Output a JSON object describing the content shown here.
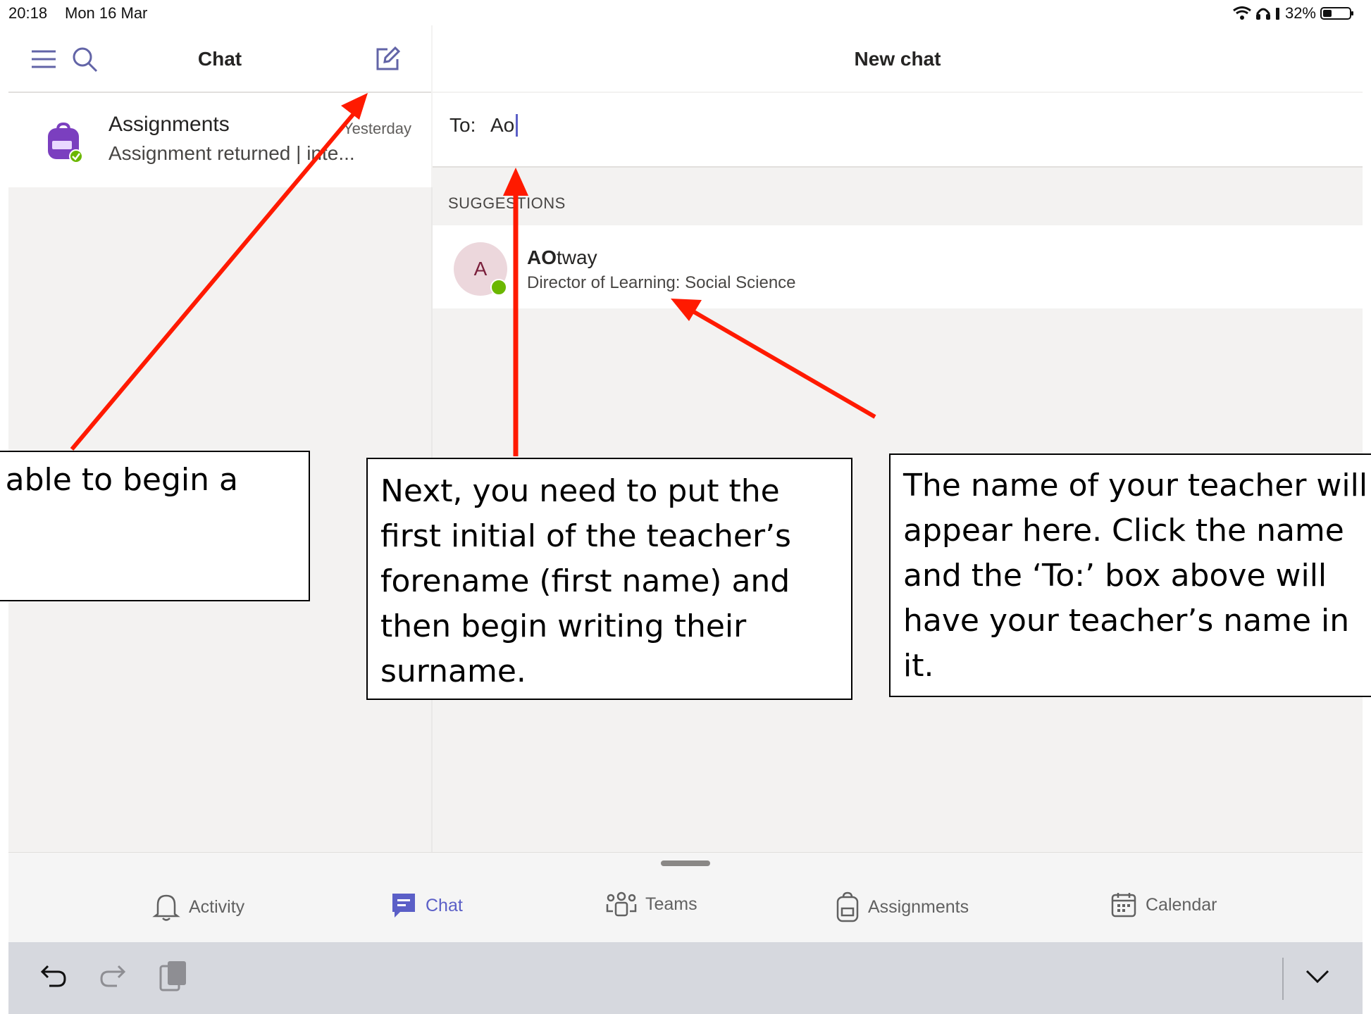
{
  "status_bar": {
    "time": "20:18",
    "date": "Mon 16 Mar",
    "battery": "32%",
    "battery_level": 0.32,
    "icons": [
      "wifi-icon",
      "headphones-icon",
      "signal-icon",
      "battery-icon"
    ]
  },
  "chat_pane": {
    "title": "Chat",
    "icons": {
      "menu": "hamburger-icon",
      "search": "search-icon",
      "new_chat": "compose-icon"
    },
    "items": [
      {
        "name": "Assignments",
        "time": "Yesterday",
        "preview": "Assignment returned | inte..."
      }
    ]
  },
  "new_chat": {
    "title": "New chat",
    "to_label": "To:",
    "to_value": "Ao",
    "suggestions_label": "SUGGESTIONS",
    "suggestion": {
      "initial": "A",
      "name_bold": "AO",
      "name_rest": "tway",
      "role": "Director of Learning: Social Science"
    }
  },
  "tabs": [
    {
      "label": "Activity",
      "icon": "bell-icon",
      "active": false
    },
    {
      "label": "Chat",
      "icon": "chat-icon",
      "active": true
    },
    {
      "label": "Teams",
      "icon": "teams-icon",
      "active": false
    },
    {
      "label": "Assignments",
      "icon": "backpack-icon",
      "active": false
    },
    {
      "label": "Calendar",
      "icon": "calendar-icon",
      "active": false
    }
  ],
  "keyboard_bar": {
    "icons": [
      "undo-icon",
      "redo-icon",
      "paste-icon",
      "chevron-down-icon"
    ]
  },
  "annotations": [
    {
      "text": "eed to click this\nbe able to begin a"
    },
    {
      "text": "Next, you need to put the\nfirst initial of the teacher’s\nforename (first name) and\nthen begin writing their\nsurname."
    },
    {
      "text": "The name of your teacher will\nappear here. Click the name\nand the ‘To:’ box above will\nhave your teacher’s name in\nit."
    }
  ],
  "colors": {
    "accent": "#5b5fc7",
    "presence": "#6bb700",
    "annotation_arrow": "#ff1a00"
  }
}
